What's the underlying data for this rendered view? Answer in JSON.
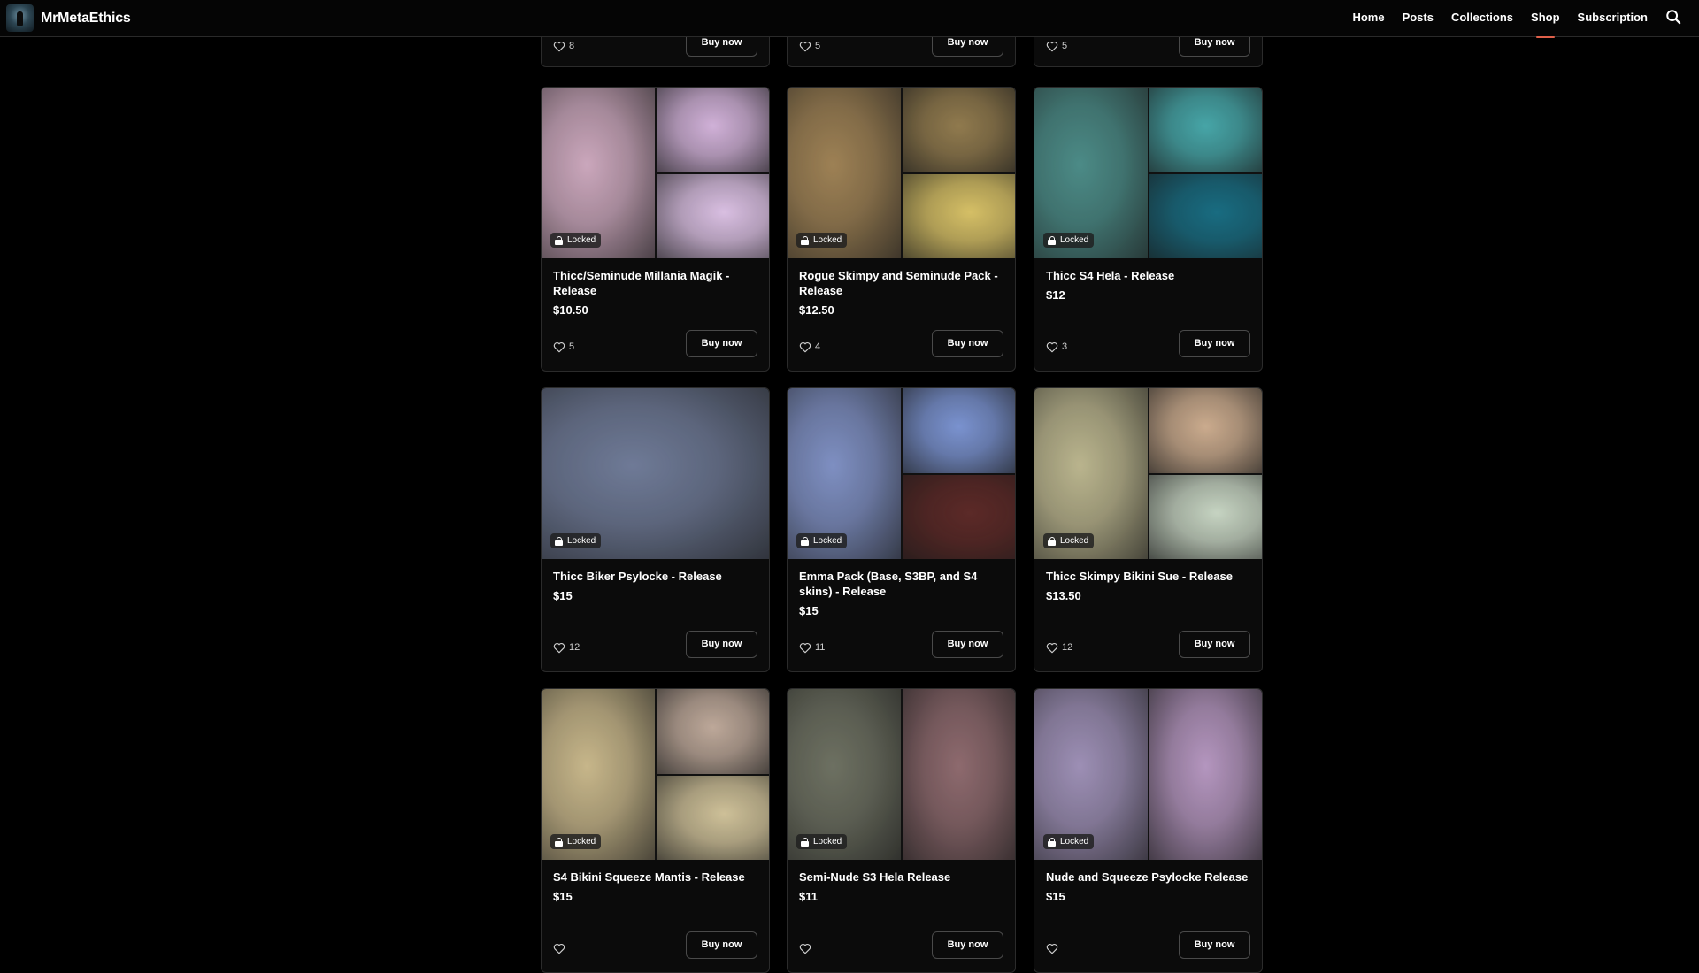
{
  "brand": {
    "name": "MrMetaEthics"
  },
  "nav": {
    "items": [
      {
        "label": "Home"
      },
      {
        "label": "Posts"
      },
      {
        "label": "Collections"
      },
      {
        "label": "Shop",
        "active": true
      },
      {
        "label": "Subscription"
      }
    ],
    "accent_color": "#e0604a"
  },
  "shop": {
    "buy_label": "Buy now",
    "locked_label": "Locked",
    "partial_row": [
      {
        "likes": "8"
      },
      {
        "likes": "5"
      },
      {
        "likes": "5"
      }
    ],
    "products": [
      {
        "title": "Thicc/Seminude Millania Magik - Release",
        "price": "$10.50",
        "likes": "5",
        "layout": 3,
        "tiles": [
          "#c9a7bb",
          "#cfb1d6",
          "#d8bfe0"
        ]
      },
      {
        "title": "Rogue Skimpy and Seminude Pack - Release",
        "price": "$12.50",
        "likes": "4",
        "layout": 3,
        "tiles": [
          "#9c8157",
          "#8f7a50",
          "#d4bf6a"
        ]
      },
      {
        "title": "Thicc S4 Hela - Release",
        "price": "$12",
        "likes": "3",
        "layout": 3,
        "tiles": [
          "#4e8a86",
          "#4aa4a6",
          "#1c6b7f"
        ]
      },
      {
        "title": "Thicc Biker Psylocke - Release",
        "price": "$15",
        "likes": "12",
        "layout": 1,
        "tiles": [
          "#6f7a95"
        ]
      },
      {
        "title": "Emma Pack (Base, S3BP, and S4 skins) - Release",
        "price": "$15",
        "likes": "11",
        "layout": 3,
        "tiles": [
          "#7f8fbf",
          "#7b92cc",
          "#5a2a28"
        ]
      },
      {
        "title": "Thicc Skimpy Bikini Sue - Release",
        "price": "$13.50",
        "likes": "12",
        "layout": 3,
        "tiles": [
          "#b9b48f",
          "#c9ab8f",
          "#c6d3c2"
        ]
      },
      {
        "title": "S4 Bikini Squeeze Mantis - Release",
        "price": "$15",
        "likes": "",
        "layout": 3,
        "tiles": [
          "#c6b68c",
          "#bca89a",
          "#cdc09a"
        ]
      },
      {
        "title": "Semi-Nude S3 Hela Release",
        "price": "$11",
        "likes": "",
        "layout": 2,
        "tiles": [
          "#6d7062",
          "#8c6a6e"
        ]
      },
      {
        "title": "Nude and Squeeze Psylocke Release",
        "price": "$15",
        "likes": "",
        "layout": 2,
        "tiles": [
          "#9c8fb3",
          "#b396bd"
        ]
      }
    ]
  }
}
